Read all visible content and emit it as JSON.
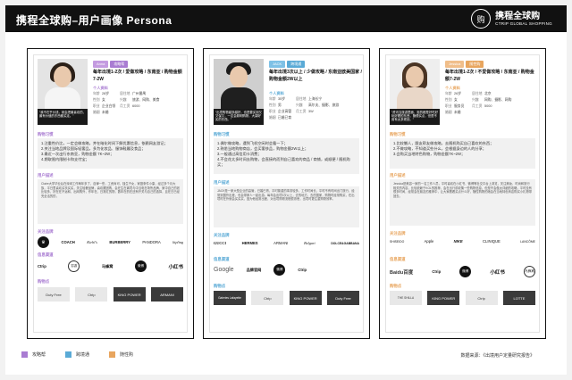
{
  "header": {
    "title": "携程全球购–用户画像 Persona",
    "logo_cn": "携程全球购",
    "logo_en": "CTRIP GLOBAL SHOPPING",
    "logo_mark": "购"
  },
  "colors": {
    "strategy": "#a97cd2",
    "travel": "#5aaad6",
    "casual": "#e8a55e"
  },
  "cards": [
    {
      "name": "Anna",
      "tag": "攻略帮",
      "quote": "“我不在乎价钱，就会把最喜欢的，最有价值的东西都买走。”",
      "slogan": "每年出境1-2次 / 爱做攻略 / 东南亚 / 购物金额7-2W",
      "info_title": "个人资料",
      "info": [
        [
          "年龄",
          "28岁",
          "居住地",
          "广州番禺"
        ],
        [
          "性别",
          "女",
          "兴趣",
          "旅游、网购、美食"
        ],
        [
          "职业",
          "企业白领",
          "月工资",
          "6000"
        ],
        [
          "婚姻",
          "未婚",
          "",
          ""
        ]
      ],
      "habit_title": "购物习惯",
      "habits": [
        "1.注重性价比，一定会做攻略，并在暗化时间下解优惠信息，依赖网友游记；",
        "2.关注当地品牌及国际轻奢品，多为化妆品、服饰鞋履及食品；",
        "3.最近一次出行东南亚，购物金额 7K~2W；",
        "4.期取限内限制卡和支付宝；"
      ],
      "bio_title": "用户描述",
      "bio": "Claire大学毕业后在深圳工作两年多了，自律一些，工资尚可，独生子女，家庭条件小康，经过多个月大族，平日里喜欢买衣买买，关注轻奢品牌，喜欢跟团购，会在生在离境与中当电在场所品牌，家中自己的钱比较多，好在在不远和，出网购外，作年在，日常红的物，数年在的在还有开关与自己的选择，且在日已经完全活的的，",
      "brands_title": "关注品牌",
      "brands": [
        "COACH",
        "Kiehl's",
        "BURBERRY",
        "PANDORA",
        "kipling"
      ],
      "channels_title": "信息渠道",
      "channels": [
        "Ctrip",
        "穷游",
        "马蜂窝",
        "微博",
        "小红书"
      ],
      "stores_title": "购物点",
      "stores": [
        "Duty Free",
        "Ctrip",
        "KING POWER",
        "ARMANI"
      ]
    },
    {
      "name": "JACK",
      "tag": "跨境通",
      "quote": "“出境购物越多越好，也是要买到又又保又，一定会精明购物，大肆好买的东西。”",
      "slogan": "每年出境3次以上 / 少做攻略 / 东南亚欧美国家 / 购物金额2W以上",
      "info_title": "个人资料",
      "info": [
        [
          "年龄",
          "35岁",
          "居住地",
          "上海长宁"
        ],
        [
          "性别",
          "男",
          "兴趣",
          "高尔夫、摄影、旅游"
        ],
        [
          "职业",
          "企业高管",
          "月工资",
          "3W"
        ],
        [
          "婚姻",
          "已婚已育",
          "",
          ""
        ]
      ],
      "habit_title": "购物习惯",
      "habits": [
        "1.偶尔做攻略，遇到飞机空闲时会看一下；",
        "2.熟悉当地购物商店，会买奢侈品，购物金额2W以上；",
        "3.一般通过高信用卡消费；",
        "4.不会花太多时间去购物，会直接的而到自己喜欢的商品 / 商铺，或顺便 / 随机购买；"
      ],
      "bio_title": "用户描述",
      "bio": "JACK是一家大型企业的高管，已婚已育，平时繁重的事务较多，工作时间长，平时不有时间出门旅行，经常到国外出差，也会带家人一起出游。每年会出境3次以上，去的地方，去的国家，购物时经常购买，在出境时在外就会买买买，因为他经常出差，对出境购物流程很熟悉，出境时更注重购物效率。",
      "brands_title": "关注品牌",
      "brands": [
        "GUCCI",
        "HERMES",
        "ARMANI",
        "Bvlgari",
        "DOLCE&GABBANA"
      ],
      "channels_title": "信息渠道",
      "channels": [
        "Google",
        "品牌官网",
        "微博",
        "Ctrip"
      ],
      "stores_title": "购物点",
      "stores": [
        "Galeries Lafayette",
        "Ctrip",
        "KING POWER",
        "Duty Free"
      ]
    },
    {
      "name": "Jessica",
      "tag": "随性购",
      "quote": "“资讯当旅游里面，逛的都是好吃好玩好看的东西，随便买点，但是不用有太多规划。”",
      "slogan": "每年出境1-2次 / 不爱做攻略 / 东南亚 / 购物金额7-2W",
      "info_title": "个人资料",
      "info": [
        [
          "年龄",
          "26岁",
          "居住地",
          "北京"
        ],
        [
          "性别",
          "女",
          "兴趣",
          "网购、摄影、网购"
        ],
        [
          "职业",
          "服务员",
          "月工资",
          "5000"
        ],
        [
          "婚姻",
          "未婚",
          "",
          ""
        ]
      ],
      "habit_title": "购物习惯",
      "habits": [
        "1.比较懒人，跟友帮友做攻略，去随机购买自己喜欢的东西；",
        "2.不做攻略，不知道买些什么，会根据身边的人的分享；",
        "3.会购买当地特色购物，购物金额7K~2W；"
      ],
      "bio_title": "用户描述",
      "bio": "Jessica是美容一家的一名工作人员，平时喜欢在小红书、微博等社交平台上浏览，关注美妆、时尚和旅行相关的内容，比较依赖于KOL的推荐，会在出行前收集一些购物信息，但是不会做太详细的攻略，平时没有很多时间，经常会在朋友的推荐中，让大家看看买点什么好，随性购物的她会在当地特色商店购买小礼物带回去。",
      "brands_title": "关注品牌",
      "brands": [
        "SHISEIDO",
        "Apple",
        "NIKE",
        "CLINIQUE",
        "LANCÔME"
      ],
      "channels_title": "信息渠道",
      "channels": [
        "Baidu百度",
        "Ctrip",
        "微博",
        "小红书",
        "马蜂窝"
      ],
      "stores_title": "购物点",
      "stores": [
        "THE SHILLA",
        "KING POWER",
        "Ctrip",
        "LOTTE"
      ]
    }
  ],
  "legend": [
    {
      "label": "攻略帮",
      "color": "#a97cd2"
    },
    {
      "label": "跨境通",
      "color": "#5aaad6"
    },
    {
      "label": "随性购",
      "color": "#e8a55e"
    }
  ],
  "source": "数据来源：《出境用户定量研究报告》"
}
